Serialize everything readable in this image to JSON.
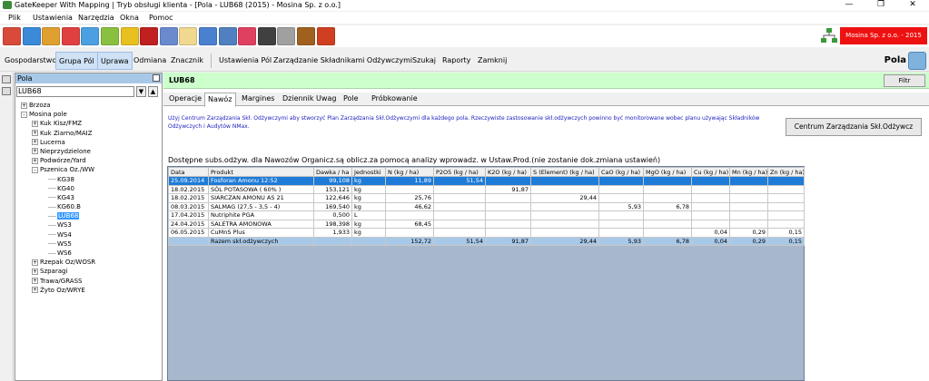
{
  "window": {
    "title": "GateKeeper With Mapping | Tryb obsługi klienta - [Pola - LUB68 (2015) - Mosina Sp. z o.o.]",
    "min": "—",
    "max": "❐",
    "close": "✕"
  },
  "menu": [
    "Plik",
    "Ustawienia",
    "Narzędzia",
    "Okna",
    "Pomoc"
  ],
  "toolbar": {
    "icons": [
      "home",
      "globe-arrow",
      "house-check",
      "house-green",
      "magnifier",
      "note-green",
      "note-yellow",
      "red-box",
      "book-stack",
      "envelope",
      "globe-paper",
      "clipboard",
      "chart",
      "printer",
      "calculator",
      "owl",
      "refresh"
    ],
    "colors": [
      "#d84a3a",
      "#3a8ad8",
      "#e0a030",
      "#e04040",
      "#4aa0e0",
      "#8ac040",
      "#e8c020",
      "#c02020",
      "#6a8ad0",
      "#f0d890",
      "#4a80d0",
      "#5080c0",
      "#e04060",
      "#404040",
      "#a0a0a0",
      "#a06020",
      "#d04020"
    ],
    "company": "Mosina Sp. z o.o. - 2015"
  },
  "nav": {
    "items": [
      "Gospodarstwo",
      "Grupa Pól",
      "Uprawa",
      "Odmiana",
      "Znacznik"
    ],
    "items2": [
      "Ustawienia Pól",
      "Zarządzanie Składnikami Odżywczymi",
      "Szukaj",
      "Raporty",
      "Zamknij"
    ],
    "right_label": "Pola"
  },
  "left": {
    "header": "Pola",
    "search": "LUB68",
    "tree": [
      {
        "label": "Brzoza",
        "level": 1,
        "exp": "+"
      },
      {
        "label": "Mosina pole",
        "level": 1,
        "exp": "-"
      },
      {
        "label": "Kuk Kisz/FMZ",
        "level": 2,
        "exp": "+"
      },
      {
        "label": "Kuk Ziarno/MAIZ",
        "level": 2,
        "exp": "+"
      },
      {
        "label": "Lucerna",
        "level": 2,
        "exp": "+"
      },
      {
        "label": "Nieprzydzielone",
        "level": 2,
        "exp": "+"
      },
      {
        "label": "Podwórze/Yard",
        "level": 2,
        "exp": "+"
      },
      {
        "label": "Pszenica Oz./WW",
        "level": 2,
        "exp": "-"
      },
      {
        "label": "KG38",
        "level": 3,
        "exp": ""
      },
      {
        "label": "KG40",
        "level": 3,
        "exp": ""
      },
      {
        "label": "KG43",
        "level": 3,
        "exp": ""
      },
      {
        "label": "KG60.B",
        "level": 3,
        "exp": ""
      },
      {
        "label": "LUB68",
        "level": 3,
        "exp": "",
        "sel": true
      },
      {
        "label": "WS3",
        "level": 3,
        "exp": ""
      },
      {
        "label": "WS4",
        "level": 3,
        "exp": ""
      },
      {
        "label": "WS5",
        "level": 3,
        "exp": ""
      },
      {
        "label": "WS6",
        "level": 3,
        "exp": ""
      },
      {
        "label": "Rzepak Oz/WOSR",
        "level": 2,
        "exp": "+"
      },
      {
        "label": "Szparagi",
        "level": 2,
        "exp": "+"
      },
      {
        "label": "Trawa/GRASS",
        "level": 2,
        "exp": "+"
      },
      {
        "label": "Żyto Oz/WRYE",
        "level": 2,
        "exp": "+"
      }
    ]
  },
  "main": {
    "field": "LUB68",
    "filter": "Filtr",
    "tabs": [
      "Operacje",
      "Nawóz",
      "Margines",
      "Dziennik Uwag",
      "Pole",
      "Próbkowanie"
    ],
    "info": "Użyj Centrum Zarządzania Skł. Odżywczymi aby stworzyć Plan Zarządzania Skł.Odżywczymi dla każdego pola. Rzeczywiste zastosowanie skł.odżywczych powinno być monitorowane wobec planu używając Składników Odżywczych i Audytów NMax.",
    "centrum": "Centrum Zarządzania Skł.Odżywcz",
    "subs": "Dostępne subs.odżyw. dla Nawozów Organicz.są oblicz.za pomocą analizy wprowadz. w Ustaw.Prod.(nie zostanie dok.zmiana ustawień)",
    "columns": [
      "Data",
      "Produkt",
      "Dawka / ha",
      "Jednostki",
      "N (kg / ha)",
      "P2O5 (kg / ha)",
      "K2O (kg / ha)",
      "S (Element) (kg / ha)",
      "CaO (kg / ha)",
      "MgO (kg / ha)",
      "Cu (kg / ha)",
      "Mn (kg / ha)",
      "Zn (kg / ha)"
    ],
    "rows": [
      [
        "25.09.2014",
        "Fosforan Amonu 12:52",
        "99,108",
        "kg",
        "11,89",
        "51,54",
        "",
        "",
        "",
        "",
        "",
        "",
        ""
      ],
      [
        "18.02.2015",
        "SÓL POTASOWA ( 60% )",
        "153,121",
        "kg",
        "",
        "",
        "91,87",
        "",
        "",
        "",
        "",
        "",
        ""
      ],
      [
        "18.02.2015",
        "SIARCZAN AMONU AS 21",
        "122,646",
        "kg",
        "25,76",
        "",
        "",
        "29,44",
        "",
        "",
        "",
        "",
        ""
      ],
      [
        "08.03.2015",
        "SALMAG (27,5 - 3,5 - 4)",
        "169,540",
        "kg",
        "46,62",
        "",
        "",
        "",
        "5,93",
        "6,78",
        "",
        "",
        ""
      ],
      [
        "17.04.2015",
        "Nutriphite PGA",
        "0,500",
        "L",
        "",
        "",
        "",
        "",
        "",
        "",
        "",
        "",
        ""
      ],
      [
        "24.04.2015",
        "SALETRA AMONOWA",
        "198,398",
        "kg",
        "68,45",
        "",
        "",
        "",
        "",
        "",
        "",
        "",
        ""
      ],
      [
        "06.05.2015",
        "CuMnS Plus",
        "1,933",
        "kg",
        "",
        "",
        "",
        "",
        "",
        "",
        "0,04",
        "0,29",
        "0,15"
      ]
    ],
    "total": [
      "",
      "Razem skł.odżywczych",
      "",
      "",
      "152,72",
      "51,54",
      "91,87",
      "29,44",
      "5,93",
      "6,78",
      "0,04",
      "0,29",
      "0,15"
    ]
  }
}
